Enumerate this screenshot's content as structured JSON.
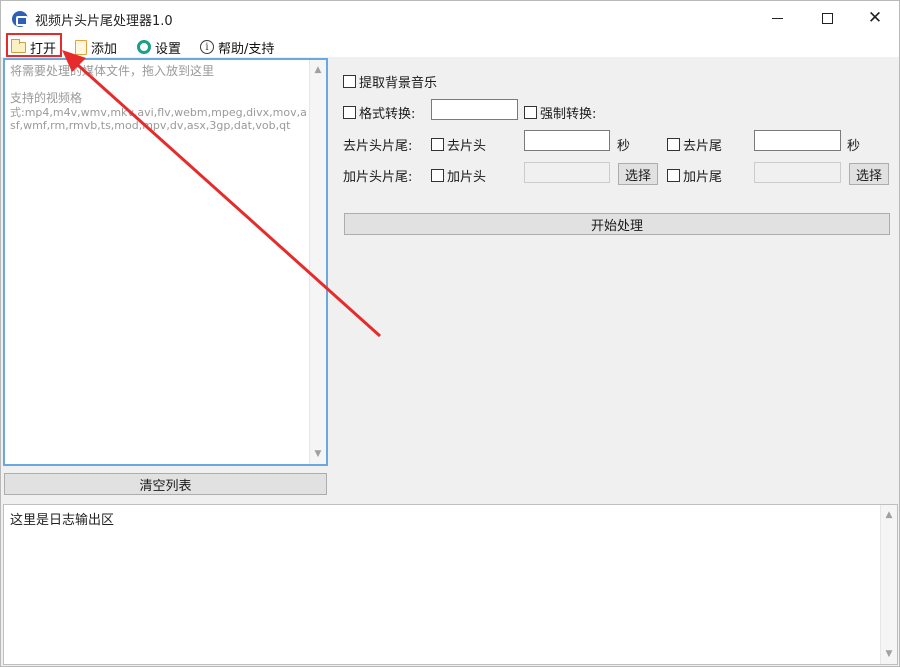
{
  "window": {
    "title": "视频片头片尾处理器1.0"
  },
  "menu": {
    "open": "打开",
    "add": "添加",
    "settings": "设置",
    "help": "帮助/支持"
  },
  "file_list": {
    "hint": "将需要处理的媒体文件，拖入放到这里",
    "supported_title": "支持的视频格",
    "formats": "式:mp4,m4v,wmv,mkv,avi,flv,webm,mpeg,divx,mov,asf,wmf,rm,rmvb,ts,mod,mpv,dv,asx,3gp,dat,vob,qt"
  },
  "buttons": {
    "clear_list": "清空列表",
    "start": "开始处理",
    "select": "选择"
  },
  "options": {
    "extract_bgm": "提取背景音乐",
    "format_convert": "格式转换:",
    "force_convert": "强制转换:",
    "remove_label": "去片头片尾:",
    "remove_head": "去片头",
    "remove_tail": "去片尾",
    "seconds": "秒",
    "add_label": "加片头片尾:",
    "add_head": "加片头",
    "add_tail": "加片尾"
  },
  "inputs": {
    "format_value": "",
    "remove_head_seconds": "",
    "remove_tail_seconds": "",
    "add_head_path": "",
    "add_tail_path": ""
  },
  "log": {
    "text": "这里是日志输出区"
  },
  "colors": {
    "highlight": "#e52b2b",
    "list_border": "#6aa9e0"
  }
}
